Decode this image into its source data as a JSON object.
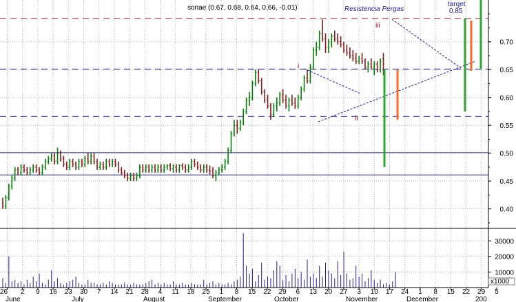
{
  "title": "sonae (0.67, 0.68, 0.64, 0.66, -0.01)",
  "colors": {
    "background": "#ffffff",
    "bar_up": "#008000",
    "bar_down": "#8b1a1a",
    "volume": "#1a1aaa",
    "grid": "#b0b0b0",
    "resistance_dashed": "#a03020",
    "support_dashed": "#1a1aaa",
    "solid_line": "#1a1aaa",
    "trend": "#1a1aaa",
    "annotation_blue": "#1a1aaa",
    "annotation_red": "#c00000",
    "green_bar": "#2ea82e",
    "orange_bar": "#ff6a20"
  },
  "chart_data": {
    "type": "ohlc",
    "price_axis": {
      "ylim": [
        0.365,
        0.775
      ],
      "ticks": [
        0.4,
        0.45,
        0.5,
        0.55,
        0.6,
        0.65,
        0.7
      ],
      "tick_labels": [
        "0.40",
        "0.45",
        "0.50",
        "0.55",
        "0.60",
        "0.65",
        "0.70"
      ]
    },
    "volume_axis": {
      "ylim": [
        0,
        38000
      ],
      "ticks": [
        10000,
        20000,
        30000
      ],
      "tick_labels": [
        "10000",
        "20000",
        "30000"
      ],
      "unit_label": "x1000"
    },
    "x_axis": {
      "day_labels": [
        "26",
        "2",
        "9",
        "16",
        "23",
        "30",
        "7",
        "14",
        "21",
        "28",
        "4",
        "11",
        "18",
        "25",
        "1",
        "8",
        "15",
        "22",
        "29",
        "6",
        "13",
        "20",
        "27",
        "3",
        "10",
        "17",
        "24",
        "1",
        "8",
        "15",
        "22",
        "29",
        "5"
      ],
      "month_labels": [
        "June",
        "July",
        "August",
        "September",
        "October",
        "November",
        "December",
        "200"
      ]
    },
    "horizontal_lines": [
      {
        "style": "dashed",
        "role": "resistance",
        "value": 0.742
      },
      {
        "style": "dashed",
        "role": "support",
        "value": 0.651
      },
      {
        "style": "dashed",
        "role": "support",
        "value": 0.566
      },
      {
        "style": "solid",
        "value": 0.501
      },
      {
        "style": "solid",
        "value": 0.461
      }
    ],
    "annotations": [
      {
        "text": "Resistencia Pergas",
        "color": "blue"
      },
      {
        "text": "target",
        "color": "blue"
      },
      {
        "text": "0.85",
        "color": "blue"
      },
      {
        "text": "i",
        "color": "red"
      },
      {
        "text": "ii",
        "color": "red"
      },
      {
        "text": "iii",
        "color": "red"
      }
    ],
    "series_ohlc": [
      {
        "o": 0.41,
        "h": 0.42,
        "l": 0.4,
        "c": 0.405
      },
      {
        "o": 0.405,
        "h": 0.425,
        "l": 0.4,
        "c": 0.42
      },
      {
        "o": 0.42,
        "h": 0.445,
        "l": 0.415,
        "c": 0.44
      },
      {
        "o": 0.44,
        "h": 0.46,
        "l": 0.435,
        "c": 0.455
      },
      {
        "o": 0.455,
        "h": 0.475,
        "l": 0.45,
        "c": 0.47
      },
      {
        "o": 0.47,
        "h": 0.475,
        "l": 0.46,
        "c": 0.465
      },
      {
        "o": 0.465,
        "h": 0.48,
        "l": 0.46,
        "c": 0.475
      },
      {
        "o": 0.475,
        "h": 0.48,
        "l": 0.465,
        "c": 0.47
      },
      {
        "o": 0.47,
        "h": 0.475,
        "l": 0.46,
        "c": 0.465
      },
      {
        "o": 0.465,
        "h": 0.475,
        "l": 0.46,
        "c": 0.47
      },
      {
        "o": 0.47,
        "h": 0.48,
        "l": 0.465,
        "c": 0.475
      },
      {
        "o": 0.475,
        "h": 0.48,
        "l": 0.465,
        "c": 0.47
      },
      {
        "o": 0.47,
        "h": 0.475,
        "l": 0.46,
        "c": 0.465
      },
      {
        "o": 0.465,
        "h": 0.48,
        "l": 0.46,
        "c": 0.475
      },
      {
        "o": 0.475,
        "h": 0.49,
        "l": 0.47,
        "c": 0.485
      },
      {
        "o": 0.485,
        "h": 0.495,
        "l": 0.48,
        "c": 0.49
      },
      {
        "o": 0.49,
        "h": 0.5,
        "l": 0.485,
        "c": 0.495
      },
      {
        "o": 0.495,
        "h": 0.5,
        "l": 0.48,
        "c": 0.485
      },
      {
        "o": 0.485,
        "h": 0.51,
        "l": 0.48,
        "c": 0.5
      },
      {
        "o": 0.5,
        "h": 0.505,
        "l": 0.485,
        "c": 0.49
      },
      {
        "o": 0.49,
        "h": 0.495,
        "l": 0.475,
        "c": 0.48
      },
      {
        "o": 0.48,
        "h": 0.485,
        "l": 0.47,
        "c": 0.475
      },
      {
        "o": 0.475,
        "h": 0.49,
        "l": 0.47,
        "c": 0.485
      },
      {
        "o": 0.485,
        "h": 0.49,
        "l": 0.475,
        "c": 0.48
      },
      {
        "o": 0.48,
        "h": 0.485,
        "l": 0.47,
        "c": 0.475
      },
      {
        "o": 0.475,
        "h": 0.49,
        "l": 0.47,
        "c": 0.485
      },
      {
        "o": 0.485,
        "h": 0.49,
        "l": 0.475,
        "c": 0.48
      },
      {
        "o": 0.48,
        "h": 0.495,
        "l": 0.475,
        "c": 0.49
      },
      {
        "o": 0.49,
        "h": 0.5,
        "l": 0.48,
        "c": 0.485
      },
      {
        "o": 0.485,
        "h": 0.5,
        "l": 0.48,
        "c": 0.495
      },
      {
        "o": 0.495,
        "h": 0.5,
        "l": 0.48,
        "c": 0.485
      },
      {
        "o": 0.485,
        "h": 0.49,
        "l": 0.47,
        "c": 0.475
      },
      {
        "o": 0.475,
        "h": 0.485,
        "l": 0.47,
        "c": 0.48
      },
      {
        "o": 0.48,
        "h": 0.485,
        "l": 0.47,
        "c": 0.475
      },
      {
        "o": 0.475,
        "h": 0.49,
        "l": 0.47,
        "c": 0.485
      },
      {
        "o": 0.485,
        "h": 0.49,
        "l": 0.475,
        "c": 0.48
      },
      {
        "o": 0.48,
        "h": 0.49,
        "l": 0.475,
        "c": 0.485
      },
      {
        "o": 0.485,
        "h": 0.49,
        "l": 0.475,
        "c": 0.48
      },
      {
        "o": 0.48,
        "h": 0.485,
        "l": 0.465,
        "c": 0.47
      },
      {
        "o": 0.47,
        "h": 0.475,
        "l": 0.46,
        "c": 0.465
      },
      {
        "o": 0.465,
        "h": 0.47,
        "l": 0.455,
        "c": 0.46
      },
      {
        "o": 0.46,
        "h": 0.465,
        "l": 0.45,
        "c": 0.455
      },
      {
        "o": 0.455,
        "h": 0.465,
        "l": 0.45,
        "c": 0.46
      },
      {
        "o": 0.46,
        "h": 0.465,
        "l": 0.45,
        "c": 0.455
      },
      {
        "o": 0.455,
        "h": 0.465,
        "l": 0.45,
        "c": 0.46
      },
      {
        "o": 0.46,
        "h": 0.48,
        "l": 0.455,
        "c": 0.475
      },
      {
        "o": 0.475,
        "h": 0.48,
        "l": 0.465,
        "c": 0.47
      },
      {
        "o": 0.47,
        "h": 0.48,
        "l": 0.465,
        "c": 0.475
      },
      {
        "o": 0.475,
        "h": 0.48,
        "l": 0.465,
        "c": 0.47
      },
      {
        "o": 0.47,
        "h": 0.48,
        "l": 0.465,
        "c": 0.475
      },
      {
        "o": 0.475,
        "h": 0.48,
        "l": 0.465,
        "c": 0.47
      },
      {
        "o": 0.47,
        "h": 0.48,
        "l": 0.465,
        "c": 0.475
      },
      {
        "o": 0.475,
        "h": 0.48,
        "l": 0.465,
        "c": 0.47
      },
      {
        "o": 0.47,
        "h": 0.48,
        "l": 0.465,
        "c": 0.475
      },
      {
        "o": 0.475,
        "h": 0.48,
        "l": 0.47,
        "c": 0.478
      },
      {
        "o": 0.478,
        "h": 0.482,
        "l": 0.468,
        "c": 0.472
      },
      {
        "o": 0.472,
        "h": 0.48,
        "l": 0.465,
        "c": 0.475
      },
      {
        "o": 0.475,
        "h": 0.48,
        "l": 0.465,
        "c": 0.47
      },
      {
        "o": 0.47,
        "h": 0.48,
        "l": 0.465,
        "c": 0.478
      },
      {
        "o": 0.478,
        "h": 0.482,
        "l": 0.47,
        "c": 0.475
      },
      {
        "o": 0.475,
        "h": 0.48,
        "l": 0.465,
        "c": 0.47
      },
      {
        "o": 0.47,
        "h": 0.48,
        "l": 0.465,
        "c": 0.475
      },
      {
        "o": 0.475,
        "h": 0.49,
        "l": 0.47,
        "c": 0.485
      },
      {
        "o": 0.485,
        "h": 0.49,
        "l": 0.475,
        "c": 0.48
      },
      {
        "o": 0.48,
        "h": 0.485,
        "l": 0.47,
        "c": 0.475
      },
      {
        "o": 0.475,
        "h": 0.48,
        "l": 0.465,
        "c": 0.47
      },
      {
        "o": 0.47,
        "h": 0.48,
        "l": 0.465,
        "c": 0.475
      },
      {
        "o": 0.475,
        "h": 0.48,
        "l": 0.465,
        "c": 0.47
      },
      {
        "o": 0.47,
        "h": 0.478,
        "l": 0.462,
        "c": 0.468
      },
      {
        "o": 0.468,
        "h": 0.475,
        "l": 0.455,
        "c": 0.46
      },
      {
        "o": 0.46,
        "h": 0.47,
        "l": 0.45,
        "c": 0.465
      },
      {
        "o": 0.465,
        "h": 0.475,
        "l": 0.46,
        "c": 0.47
      },
      {
        "o": 0.47,
        "h": 0.48,
        "l": 0.465,
        "c": 0.475
      },
      {
        "o": 0.475,
        "h": 0.49,
        "l": 0.47,
        "c": 0.485
      },
      {
        "o": 0.485,
        "h": 0.51,
        "l": 0.48,
        "c": 0.505
      },
      {
        "o": 0.505,
        "h": 0.54,
        "l": 0.5,
        "c": 0.535
      },
      {
        "o": 0.535,
        "h": 0.56,
        "l": 0.53,
        "c": 0.55
      },
      {
        "o": 0.55,
        "h": 0.56,
        "l": 0.535,
        "c": 0.545
      },
      {
        "o": 0.545,
        "h": 0.56,
        "l": 0.54,
        "c": 0.555
      },
      {
        "o": 0.555,
        "h": 0.58,
        "l": 0.55,
        "c": 0.575
      },
      {
        "o": 0.575,
        "h": 0.6,
        "l": 0.57,
        "c": 0.595
      },
      {
        "o": 0.595,
        "h": 0.61,
        "l": 0.585,
        "c": 0.6
      },
      {
        "o": 0.6,
        "h": 0.63,
        "l": 0.595,
        "c": 0.625
      },
      {
        "o": 0.625,
        "h": 0.65,
        "l": 0.62,
        "c": 0.645
      },
      {
        "o": 0.645,
        "h": 0.65,
        "l": 0.625,
        "c": 0.63
      },
      {
        "o": 0.63,
        "h": 0.635,
        "l": 0.605,
        "c": 0.61
      },
      {
        "o": 0.61,
        "h": 0.615,
        "l": 0.59,
        "c": 0.595
      },
      {
        "o": 0.595,
        "h": 0.605,
        "l": 0.58,
        "c": 0.585
      },
      {
        "o": 0.585,
        "h": 0.59,
        "l": 0.56,
        "c": 0.57
      },
      {
        "o": 0.57,
        "h": 0.59,
        "l": 0.565,
        "c": 0.585
      },
      {
        "o": 0.585,
        "h": 0.6,
        "l": 0.575,
        "c": 0.59
      },
      {
        "o": 0.59,
        "h": 0.61,
        "l": 0.585,
        "c": 0.605
      },
      {
        "o": 0.605,
        "h": 0.615,
        "l": 0.59,
        "c": 0.595
      },
      {
        "o": 0.595,
        "h": 0.605,
        "l": 0.58,
        "c": 0.585
      },
      {
        "o": 0.585,
        "h": 0.6,
        "l": 0.575,
        "c": 0.595
      },
      {
        "o": 0.595,
        "h": 0.605,
        "l": 0.585,
        "c": 0.59
      },
      {
        "o": 0.59,
        "h": 0.6,
        "l": 0.58,
        "c": 0.585
      },
      {
        "o": 0.585,
        "h": 0.605,
        "l": 0.58,
        "c": 0.6
      },
      {
        "o": 0.6,
        "h": 0.62,
        "l": 0.595,
        "c": 0.615
      },
      {
        "o": 0.615,
        "h": 0.64,
        "l": 0.61,
        "c": 0.635
      },
      {
        "o": 0.635,
        "h": 0.65,
        "l": 0.625,
        "c": 0.63
      },
      {
        "o": 0.63,
        "h": 0.66,
        "l": 0.625,
        "c": 0.655
      },
      {
        "o": 0.655,
        "h": 0.69,
        "l": 0.65,
        "c": 0.685
      },
      {
        "o": 0.685,
        "h": 0.7,
        "l": 0.675,
        "c": 0.69
      },
      {
        "o": 0.69,
        "h": 0.72,
        "l": 0.685,
        "c": 0.715
      },
      {
        "o": 0.715,
        "h": 0.74,
        "l": 0.7,
        "c": 0.705
      },
      {
        "o": 0.705,
        "h": 0.715,
        "l": 0.68,
        "c": 0.69
      },
      {
        "o": 0.69,
        "h": 0.705,
        "l": 0.68,
        "c": 0.7
      },
      {
        "o": 0.7,
        "h": 0.715,
        "l": 0.69,
        "c": 0.71
      },
      {
        "o": 0.71,
        "h": 0.72,
        "l": 0.7,
        "c": 0.705
      },
      {
        "o": 0.705,
        "h": 0.715,
        "l": 0.695,
        "c": 0.7
      },
      {
        "o": 0.7,
        "h": 0.71,
        "l": 0.69,
        "c": 0.695
      },
      {
        "o": 0.695,
        "h": 0.7,
        "l": 0.68,
        "c": 0.685
      },
      {
        "o": 0.685,
        "h": 0.695,
        "l": 0.675,
        "c": 0.68
      },
      {
        "o": 0.68,
        "h": 0.69,
        "l": 0.67,
        "c": 0.675
      },
      {
        "o": 0.675,
        "h": 0.685,
        "l": 0.665,
        "c": 0.67
      },
      {
        "o": 0.67,
        "h": 0.68,
        "l": 0.66,
        "c": 0.665
      },
      {
        "o": 0.665,
        "h": 0.675,
        "l": 0.66,
        "c": 0.67
      },
      {
        "o": 0.67,
        "h": 0.68,
        "l": 0.66,
        "c": 0.665
      },
      {
        "o": 0.665,
        "h": 0.67,
        "l": 0.65,
        "c": 0.655
      },
      {
        "o": 0.655,
        "h": 0.665,
        "l": 0.645,
        "c": 0.66
      },
      {
        "o": 0.66,
        "h": 0.67,
        "l": 0.65,
        "c": 0.655
      },
      {
        "o": 0.655,
        "h": 0.665,
        "l": 0.64,
        "c": 0.66
      },
      {
        "o": 0.66,
        "h": 0.665,
        "l": 0.645,
        "c": 0.65
      },
      {
        "o": 0.65,
        "h": 0.67,
        "l": 0.645,
        "c": 0.665
      },
      {
        "o": 0.67,
        "h": 0.68,
        "l": 0.64,
        "c": 0.66
      }
    ],
    "volume": [
      6000,
      3000,
      20000,
      4000,
      5000,
      3000,
      4000,
      2000,
      5000,
      3000,
      7000,
      4000,
      9000,
      3000,
      2000,
      5000,
      11000,
      4000,
      6000,
      3000,
      2000,
      3000,
      4000,
      5000,
      7000,
      3000,
      2000,
      2000,
      5000,
      3000,
      3000,
      2000,
      2000,
      3000,
      2000,
      4000,
      3000,
      2000,
      2000,
      2000,
      3000,
      2000,
      2000,
      3000,
      2000,
      2000,
      2000,
      3000,
      4000,
      5000,
      2000,
      3000,
      2000,
      3000,
      2000,
      2000,
      4000,
      2000,
      2000,
      3000,
      2000,
      2000,
      3000,
      2000,
      2000,
      2000,
      5000,
      2000,
      3000,
      4000,
      2000,
      3000,
      2000,
      2000,
      3000,
      2000,
      4000,
      5000,
      7000,
      35000,
      14000,
      9000,
      12000,
      4000,
      8000,
      16000,
      5000,
      7000,
      6000,
      11000,
      17000,
      14000,
      5000,
      8000,
      4000,
      9000,
      12000,
      6000,
      10000,
      5000,
      18000,
      7000,
      9000,
      6000,
      14000,
      7000,
      16000,
      11000,
      9000,
      6000,
      17000,
      8000,
      23000,
      9000,
      5000,
      6000,
      14000,
      7000,
      9000,
      4000,
      6000,
      11000,
      5000,
      3000,
      5000,
      2000,
      3000,
      2000,
      4000,
      10000
    ],
    "vertical_bars": [
      {
        "color": "green",
        "from": 0.475,
        "to": 0.65
      },
      {
        "color": "orange",
        "from": 0.56,
        "to": 0.65
      },
      {
        "color": "green",
        "from": 0.575,
        "to": 0.742
      },
      {
        "color": "orange",
        "from": 0.648,
        "to": 0.738
      },
      {
        "color": "green",
        "from": 0.651,
        "to": 0.8
      }
    ]
  }
}
